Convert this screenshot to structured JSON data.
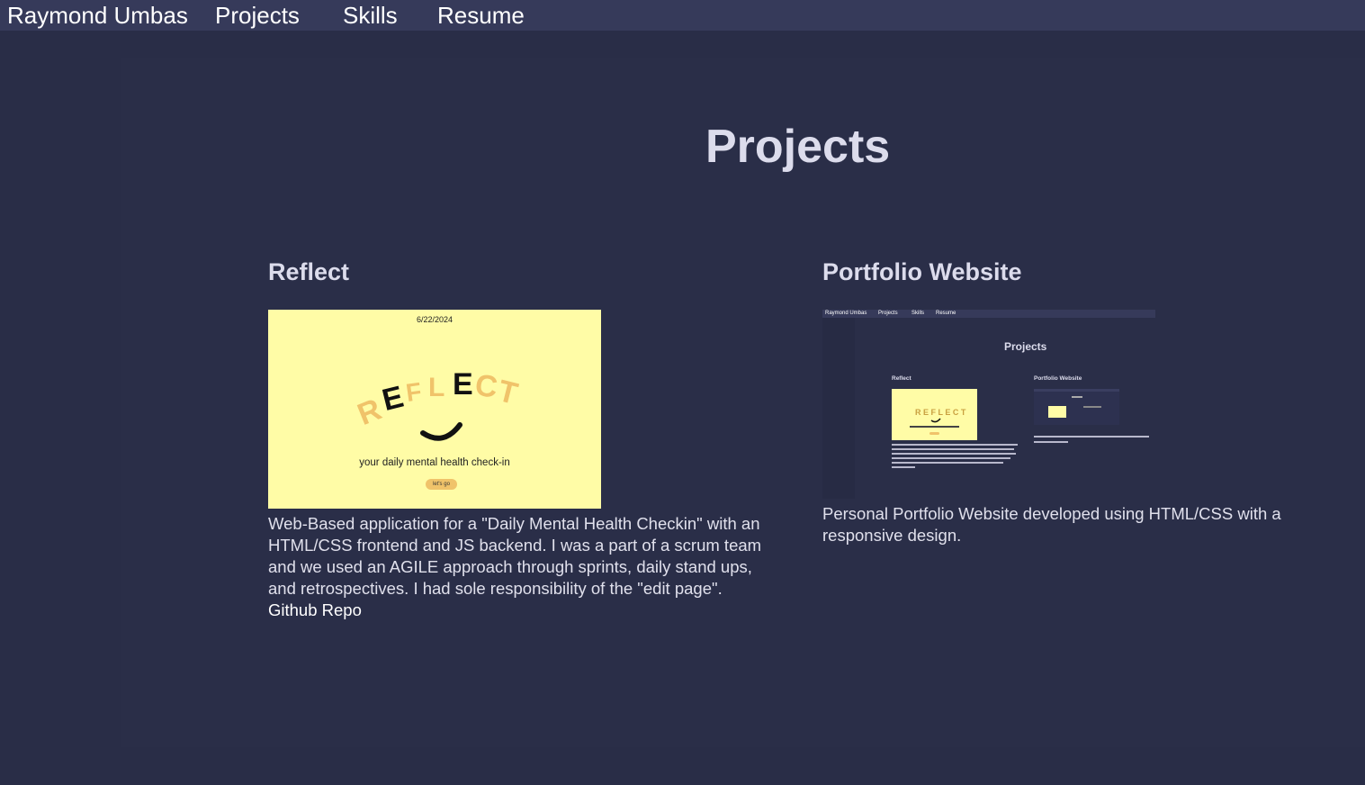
{
  "nav": {
    "brand": "Raymond Umbas",
    "items": [
      "Projects",
      "Skills",
      "Resume"
    ]
  },
  "page": {
    "title": "Projects"
  },
  "projects": [
    {
      "title": "Reflect",
      "description": "Web-Based application for a \"Daily Mental Health Checkin\" with an HTML/CSS frontend and JS backend. I was a part of a scrum team and we used an AGILE approach through sprints, daily stand ups, and retrospectives. I had sole responsibility of the \"edit page\".",
      "link_label": "Github Repo",
      "image": {
        "date": "6/22/2024",
        "logo_text": "REFLECT",
        "tagline": "your daily mental health check-in",
        "button": "let's go"
      }
    },
    {
      "title": "Portfolio Website",
      "description": "Personal Portfolio Website developed using HTML/CSS with a responsive design.",
      "image": {
        "nav_items": [
          "Raymond Umbas",
          "Projects",
          "Skills",
          "Resume"
        ],
        "title": "Projects",
        "card_titles": [
          "Reflect",
          "Portfolio Website"
        ]
      }
    }
  ],
  "colors": {
    "background": "#292d47",
    "navbar": "#363a5a",
    "reflect_bg": "#fffca6",
    "reflect_accent": "#f0c36a"
  }
}
